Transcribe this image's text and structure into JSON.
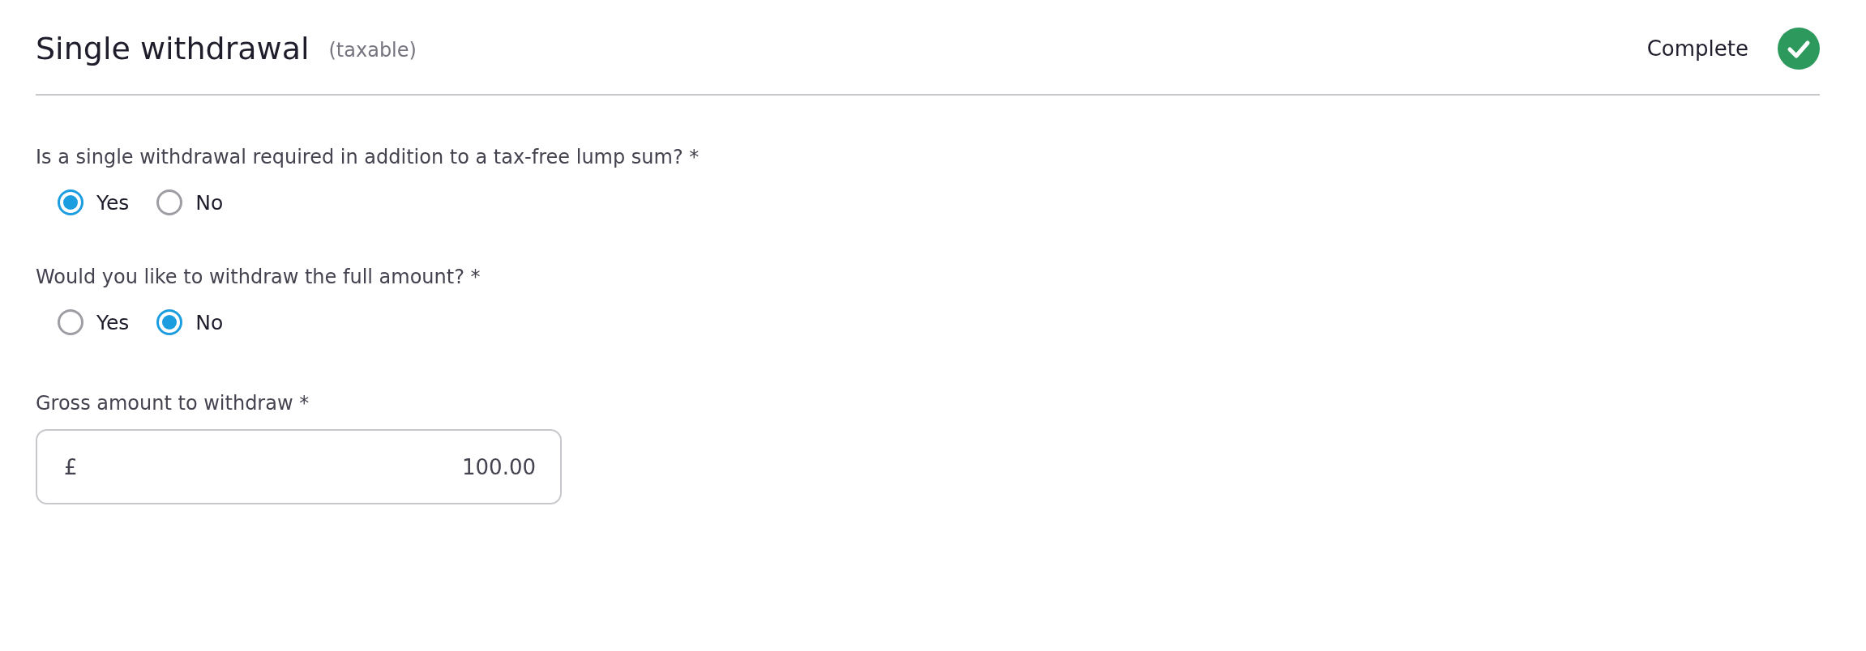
{
  "section": {
    "title": "Single withdrawal",
    "subtitle": "(taxable)",
    "status": "Complete",
    "complete": true
  },
  "questions": [
    {
      "kind": "radio",
      "label": "Is a single withdrawal required in addition to a tax-free lump sum? *",
      "options": [
        {
          "label": "Yes",
          "selected": true
        },
        {
          "label": "No",
          "selected": false
        }
      ]
    },
    {
      "kind": "radio",
      "label": "Would you like to withdraw the full amount? *",
      "options": [
        {
          "label": "Yes",
          "selected": false
        },
        {
          "label": "No",
          "selected": true
        }
      ]
    },
    {
      "kind": "amount",
      "label": "Gross amount to withdraw *",
      "currency": "£",
      "value": "100.00"
    }
  ]
}
